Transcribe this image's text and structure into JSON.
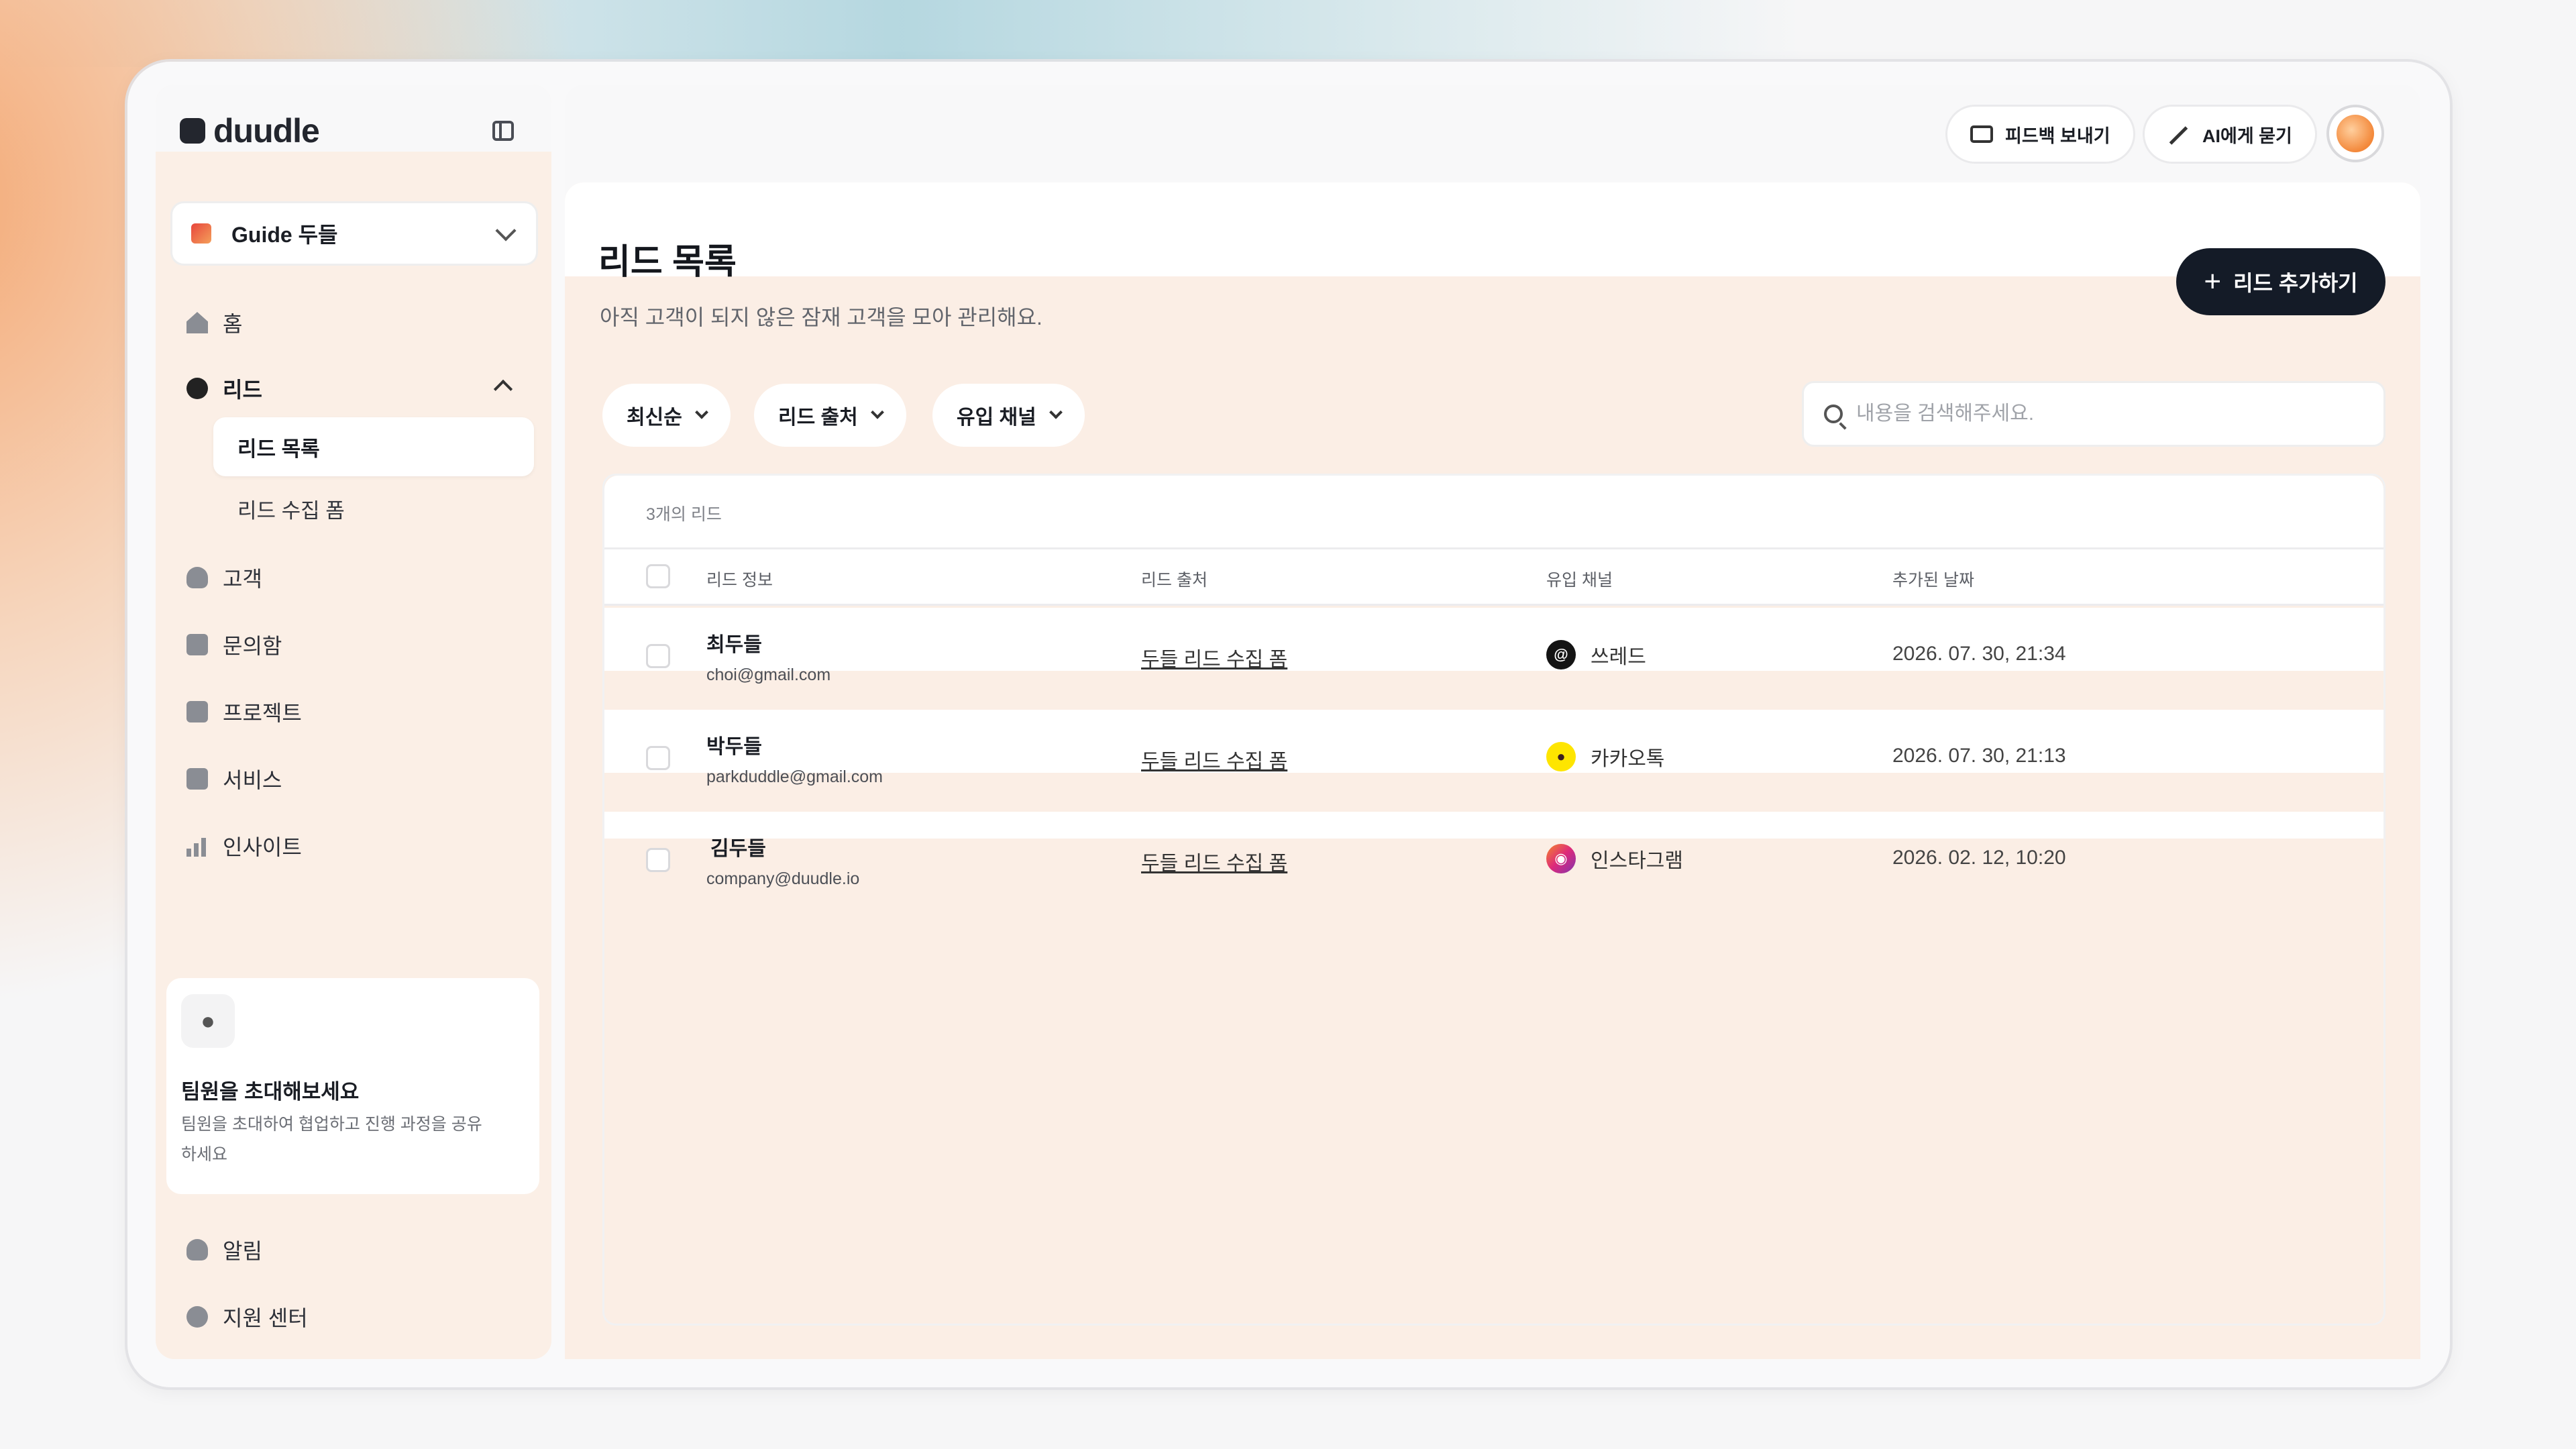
{
  "brand": {
    "logo_text": "duudle"
  },
  "workspace": {
    "name": "Guide 두들"
  },
  "sidebar": {
    "items": [
      {
        "label": "홈"
      },
      {
        "label": "리드"
      },
      {
        "label": "고객"
      },
      {
        "label": "문의함"
      },
      {
        "label": "프로젝트"
      },
      {
        "label": "서비스"
      },
      {
        "label": "인사이트"
      }
    ],
    "sub_items": [
      {
        "label": "리드 목록",
        "active": true
      },
      {
        "label": "리드 수집 폼",
        "active": false
      }
    ],
    "invite": {
      "title": "팀원을 초대해보세요",
      "desc": "팀원을 초대하여 협업하고 진행 과정을 공유하세요"
    },
    "bottom": [
      {
        "label": "알림"
      },
      {
        "label": "지원 센터"
      }
    ]
  },
  "topbar": {
    "feedback_label": "피드백 보내기",
    "ai_label": "AI에게 묻기"
  },
  "page": {
    "title": "리드 목록",
    "subtitle": "아직 고객이 되지 않은 잠재 고객을 모아 관리해요.",
    "add_button": "리드 추가하기"
  },
  "filters": {
    "sort": "최신순",
    "source": "리드 출처",
    "channel": "유입 채널",
    "search_placeholder": "내용을 검색해주세요."
  },
  "table": {
    "count_label": "3개의 리드",
    "columns": [
      "리드 정보",
      "리드 출처",
      "유입 채널",
      "추가된 날짜"
    ],
    "rows": [
      {
        "name": "최두들",
        "email": "choi@gmail.com",
        "source": "두들 리드 수집 폼",
        "channel": "쓰레드",
        "channel_icon": "threads-icon",
        "channel_color": "#141414",
        "date": "2026. 07. 30, 21:34"
      },
      {
        "name": "박두들",
        "email": "parkduddle@gmail.com",
        "source": "두들 리드 수집 폼",
        "channel": "카카오톡",
        "channel_icon": "kakaotalk-icon",
        "channel_color": "#FEE500",
        "date": "2026. 07. 30, 21:13"
      },
      {
        "name": "김두들",
        "email": "company@duudle.io",
        "source": "두들 리드 수집 폼",
        "channel": "인스타그램",
        "channel_icon": "instagram-icon",
        "channel_color": "#E1306C",
        "date": "2026. 02. 12, 10:20"
      }
    ]
  }
}
